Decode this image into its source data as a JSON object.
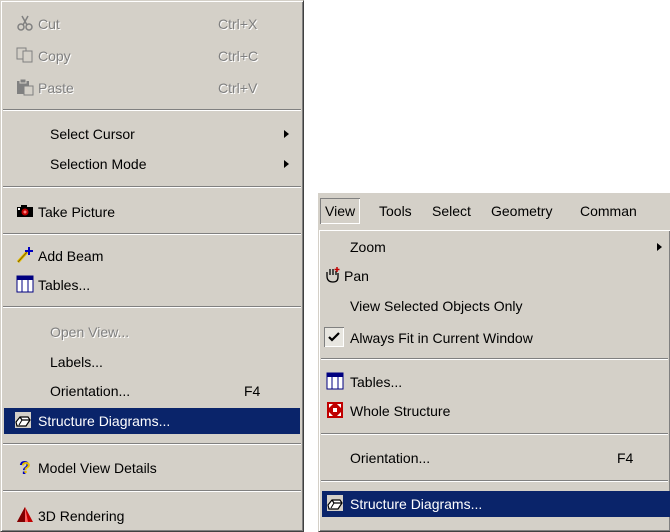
{
  "context_menu": {
    "cut": {
      "label": "Cut",
      "shortcut": "Ctrl+X"
    },
    "copy": {
      "label": "Copy",
      "shortcut": "Ctrl+C"
    },
    "paste": {
      "label": "Paste",
      "shortcut": "Ctrl+V"
    },
    "select_cursor": "Select Cursor",
    "selection_mode": "Selection Mode",
    "take_picture": "Take Picture",
    "add_beam": "Add Beam",
    "tables": "Tables...",
    "open_view": "Open View...",
    "labels": "Labels...",
    "orientation": {
      "label": "Orientation...",
      "shortcut": "F4"
    },
    "structure_diagrams": "Structure Diagrams...",
    "model_view_details": "Model View Details",
    "rendering_3d": "3D Rendering"
  },
  "menubar": {
    "items": [
      "View",
      "Tools",
      "Select",
      "Geometry",
      "Comman"
    ]
  },
  "view_menu": {
    "zoom": "Zoom",
    "pan": "Pan",
    "view_selected_only": "View Selected Objects Only",
    "always_fit": "Always Fit in Current Window",
    "always_fit_checked": true,
    "tables": "Tables...",
    "whole_structure": "Whole Structure",
    "orientation": {
      "label": "Orientation...",
      "shortcut": "F4"
    },
    "structure_diagrams": "Structure Diagrams..."
  },
  "colors": {
    "menu_bg": "#d4d0c8",
    "highlight": "#0a246a",
    "disabled_text": "#808080"
  }
}
